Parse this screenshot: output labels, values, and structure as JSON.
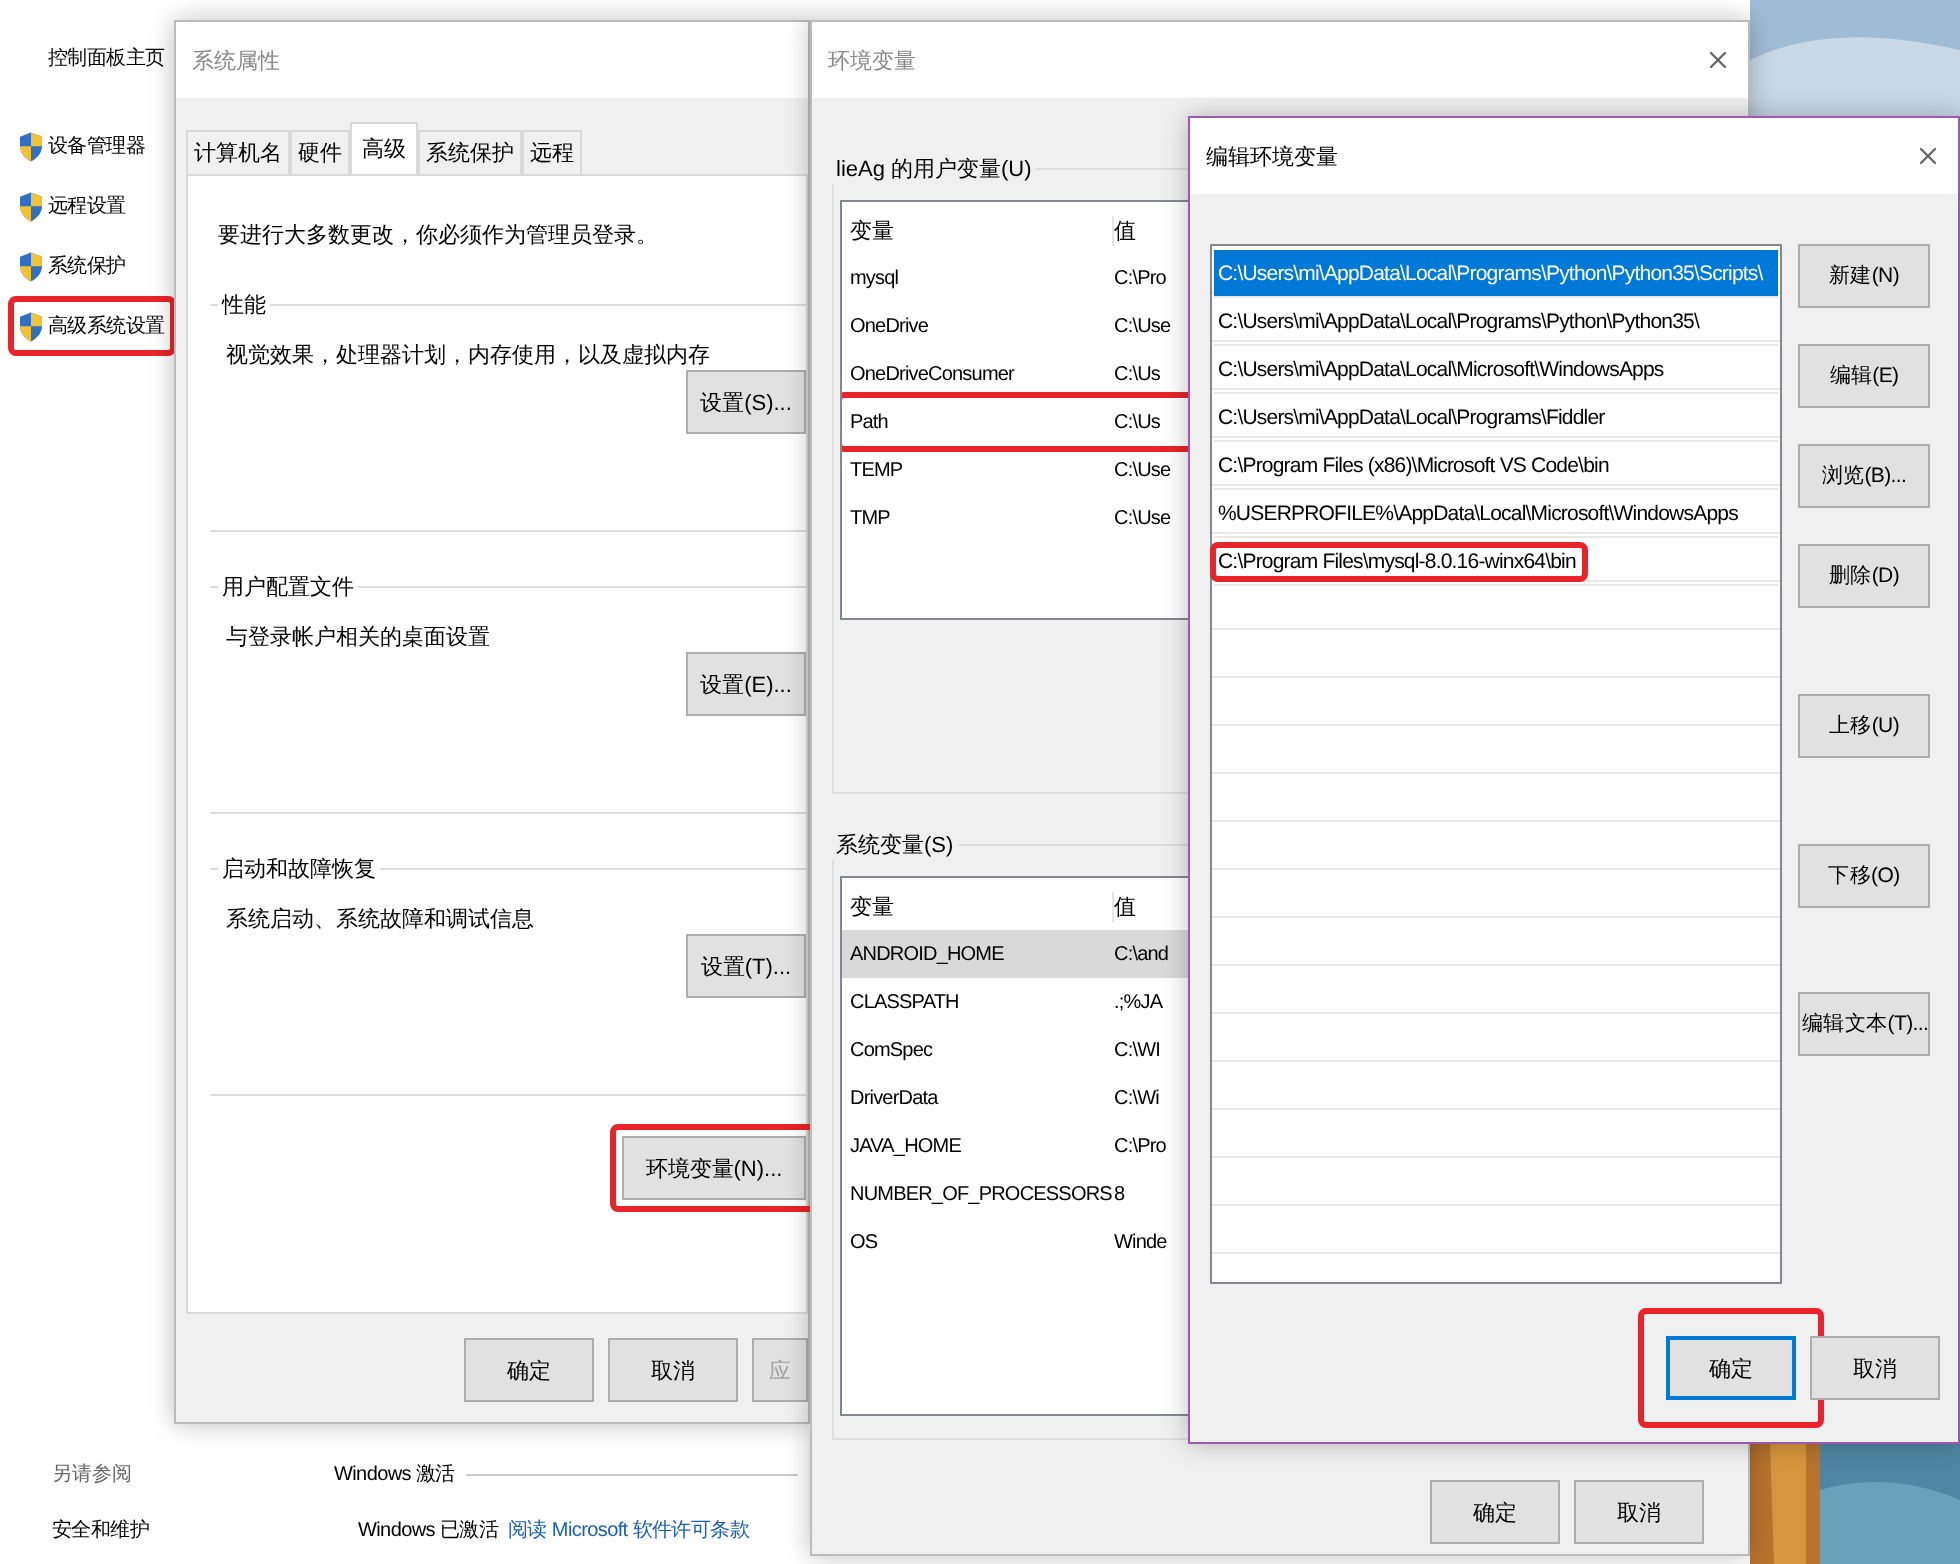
{
  "control_panel": {
    "home_link": "控制面板主页",
    "tasks": [
      {
        "label": "设备管理器",
        "highlighted": false
      },
      {
        "label": "远程设置",
        "highlighted": false
      },
      {
        "label": "系统保护",
        "highlighted": false
      },
      {
        "label": "高级系统设置",
        "highlighted": true
      }
    ],
    "see_also": {
      "heading": "另请参阅",
      "links": [
        "安全和维护"
      ]
    },
    "activation": {
      "heading": "Windows 激活",
      "status": "Windows 已激活",
      "link": "阅读 Microsoft 软件许可条款"
    }
  },
  "system_properties": {
    "title": "系统属性",
    "tabs": [
      {
        "label": "计算机名",
        "selected": false
      },
      {
        "label": "硬件",
        "selected": false
      },
      {
        "label": "高级",
        "selected": true
      },
      {
        "label": "系统保护",
        "selected": false
      },
      {
        "label": "远程",
        "selected": false
      }
    ],
    "notice": "要进行大多数更改，你必须作为管理员登录。",
    "groups": [
      {
        "title": "性能",
        "description": "视觉效果，处理器计划，内存使用，以及虚拟内存",
        "button": "设置(S)..."
      },
      {
        "title": "用户配置文件",
        "description": "与登录帐户相关的桌面设置",
        "button": "设置(E)..."
      },
      {
        "title": "启动和故障恢复",
        "description": "系统启动、系统故障和调试信息",
        "button": "设置(T)..."
      }
    ],
    "env_button": {
      "label": "环境变量(N)...",
      "highlighted": true
    },
    "buttons": [
      {
        "label": "确定",
        "disabled": false
      },
      {
        "label": "取消",
        "disabled": false
      },
      {
        "label": "应",
        "disabled": true
      }
    ]
  },
  "environment_variables": {
    "title": "环境变量",
    "user_group": {
      "title": "lieAg 的用户变量(U)",
      "columns": [
        "变量",
        "值"
      ],
      "rows": [
        {
          "name": "mysql",
          "value": "C:\\Pro",
          "selected": false,
          "highlighted": false
        },
        {
          "name": "OneDrive",
          "value": "C:\\Use",
          "selected": false,
          "highlighted": false
        },
        {
          "name": "OneDriveConsumer",
          "value": "C:\\Us",
          "selected": false,
          "highlighted": false
        },
        {
          "name": "Path",
          "value": "C:\\Us",
          "selected": false,
          "highlighted": true
        },
        {
          "name": "TEMP",
          "value": "C:\\Use",
          "selected": false,
          "highlighted": false
        },
        {
          "name": "TMP",
          "value": "C:\\Use",
          "selected": false,
          "highlighted": false
        }
      ]
    },
    "system_group": {
      "title": "系统变量(S)",
      "columns": [
        "变量",
        "值"
      ],
      "rows": [
        {
          "name": "ANDROID_HOME",
          "value": "C:\\and",
          "selected": true,
          "highlighted": false
        },
        {
          "name": "CLASSPATH",
          "value": ".;%JA",
          "selected": false,
          "highlighted": false
        },
        {
          "name": "ComSpec",
          "value": "C:\\WI",
          "selected": false,
          "highlighted": false
        },
        {
          "name": "DriverData",
          "value": "C:\\Wi",
          "selected": false,
          "highlighted": false
        },
        {
          "name": "JAVA_HOME",
          "value": "C:\\Pro",
          "selected": false,
          "highlighted": false
        },
        {
          "name": "NUMBER_OF_PROCESSORS",
          "value": "8",
          "selected": false,
          "highlighted": false
        },
        {
          "name": "OS",
          "value": "Winde",
          "selected": false,
          "highlighted": false
        }
      ]
    },
    "buttons": [
      "确定",
      "取消"
    ]
  },
  "edit_environment_variable": {
    "title": "编辑环境变量",
    "entries": [
      {
        "text": "C:\\Users\\mi\\AppData\\Local\\Programs\\Python\\Python35\\Scripts\\",
        "selected": true,
        "highlighted": false
      },
      {
        "text": "C:\\Users\\mi\\AppData\\Local\\Programs\\Python\\Python35\\",
        "selected": false,
        "highlighted": false
      },
      {
        "text": "C:\\Users\\mi\\AppData\\Local\\Microsoft\\WindowsApps",
        "selected": false,
        "highlighted": false
      },
      {
        "text": "C:\\Users\\mi\\AppData\\Local\\Programs\\Fiddler",
        "selected": false,
        "highlighted": false
      },
      {
        "text": "C:\\Program Files (x86)\\Microsoft VS Code\\bin",
        "selected": false,
        "highlighted": false
      },
      {
        "text": "%USERPROFILE%\\AppData\\Local\\Microsoft\\WindowsApps",
        "selected": false,
        "highlighted": false
      },
      {
        "text": "C:\\Program Files\\mysql-8.0.16-winx64\\bin",
        "selected": false,
        "highlighted": true
      }
    ],
    "side_buttons": [
      {
        "label": "新建(N)",
        "kind": "top"
      },
      {
        "label": "编辑(E)",
        "kind": "top"
      },
      {
        "label": "浏览(B)...",
        "kind": "top"
      },
      {
        "label": "删除(D)",
        "kind": "top"
      },
      {
        "label": "上移(U)",
        "kind": "move"
      },
      {
        "label": "下移(O)",
        "kind": "move"
      },
      {
        "label": "编辑文本(T)...",
        "kind": "text"
      }
    ],
    "buttons": [
      {
        "label": "确定",
        "focused": true,
        "highlighted": true
      },
      {
        "label": "取消",
        "focused": false,
        "highlighted": false
      }
    ]
  }
}
